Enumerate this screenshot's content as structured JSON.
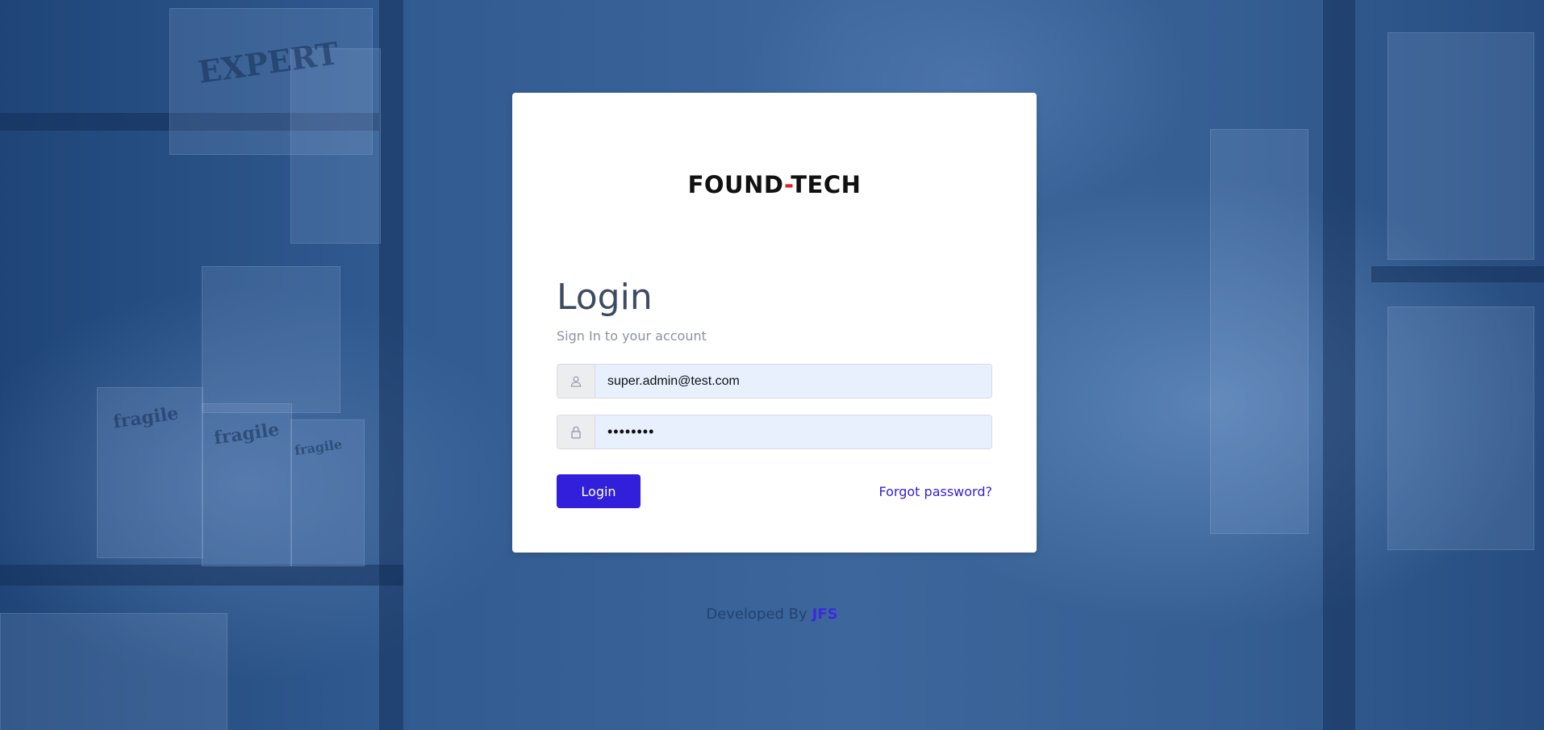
{
  "app": {
    "brand_left": "FOUND",
    "brand_dash": "-",
    "brand_right": "TECH"
  },
  "login": {
    "title": "Login",
    "subtitle": "Sign In to your account",
    "username_value": "super.admin@test.com",
    "password_value": "••••••••",
    "login_label": "Login",
    "forgot_label": "Forgot password?"
  },
  "footer": {
    "prefix": "Developed By",
    "brand": "JFS"
  },
  "background": {
    "box_labels": [
      "EXPERT",
      "fragile",
      "fragile",
      "fragile"
    ]
  },
  "colors": {
    "primary": "#321fdb",
    "background": "#2f568c",
    "card": "#ffffff",
    "input_bg": "#e8f0fe",
    "title": "#3c4b64",
    "muted": "#8a93a2",
    "logo_accent": "#e02020"
  },
  "icons": {
    "username": "user-icon",
    "password": "lock-icon"
  }
}
